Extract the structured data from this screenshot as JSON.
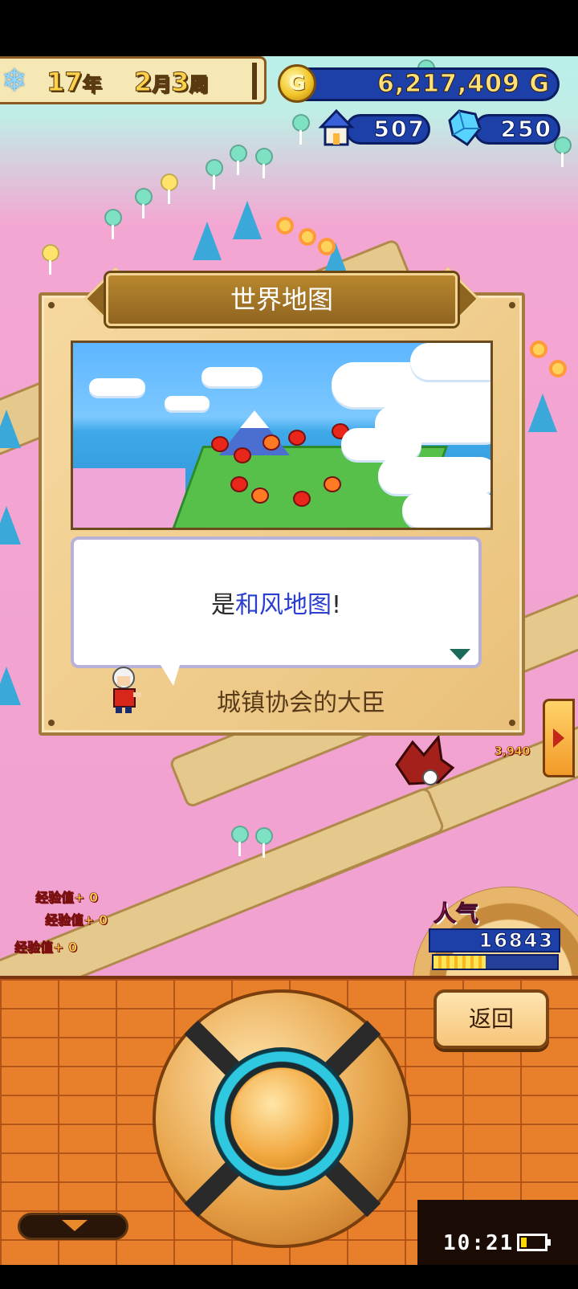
{
  "hud": {
    "date": {
      "year_num": "17",
      "year_unit": "年",
      "month_num": "2",
      "month_unit": "月",
      "week_num": "3",
      "week_unit": "周"
    },
    "gold": {
      "icon_letter": "G",
      "value": "6,217,409 G"
    },
    "population": {
      "value": "507"
    },
    "gems": {
      "value": "250"
    }
  },
  "dialog": {
    "title": "世界地图",
    "message_prefix": "是",
    "message_highlight": "和风地图",
    "message_suffix": "!",
    "speaker": "城镇协会的大臣"
  },
  "world": {
    "floating_labels": [
      {
        "text": "经验值+ 0"
      },
      {
        "text": "经验值+ 0"
      },
      {
        "text": "经验值+ 0"
      }
    ],
    "cash_popup": "3,940"
  },
  "popularity": {
    "label": "人气",
    "value": "16843",
    "meter_fraction": 0.42
  },
  "controls": {
    "back_label": "返回"
  },
  "status_bar": {
    "time": "10:21",
    "battery_fraction": 0.25
  },
  "colors": {
    "hud_blue": "#1d3fa8",
    "highlight_text": "#2a3fd0",
    "brick": "#e87f2a",
    "pink_ground": "#f1a1cf"
  }
}
